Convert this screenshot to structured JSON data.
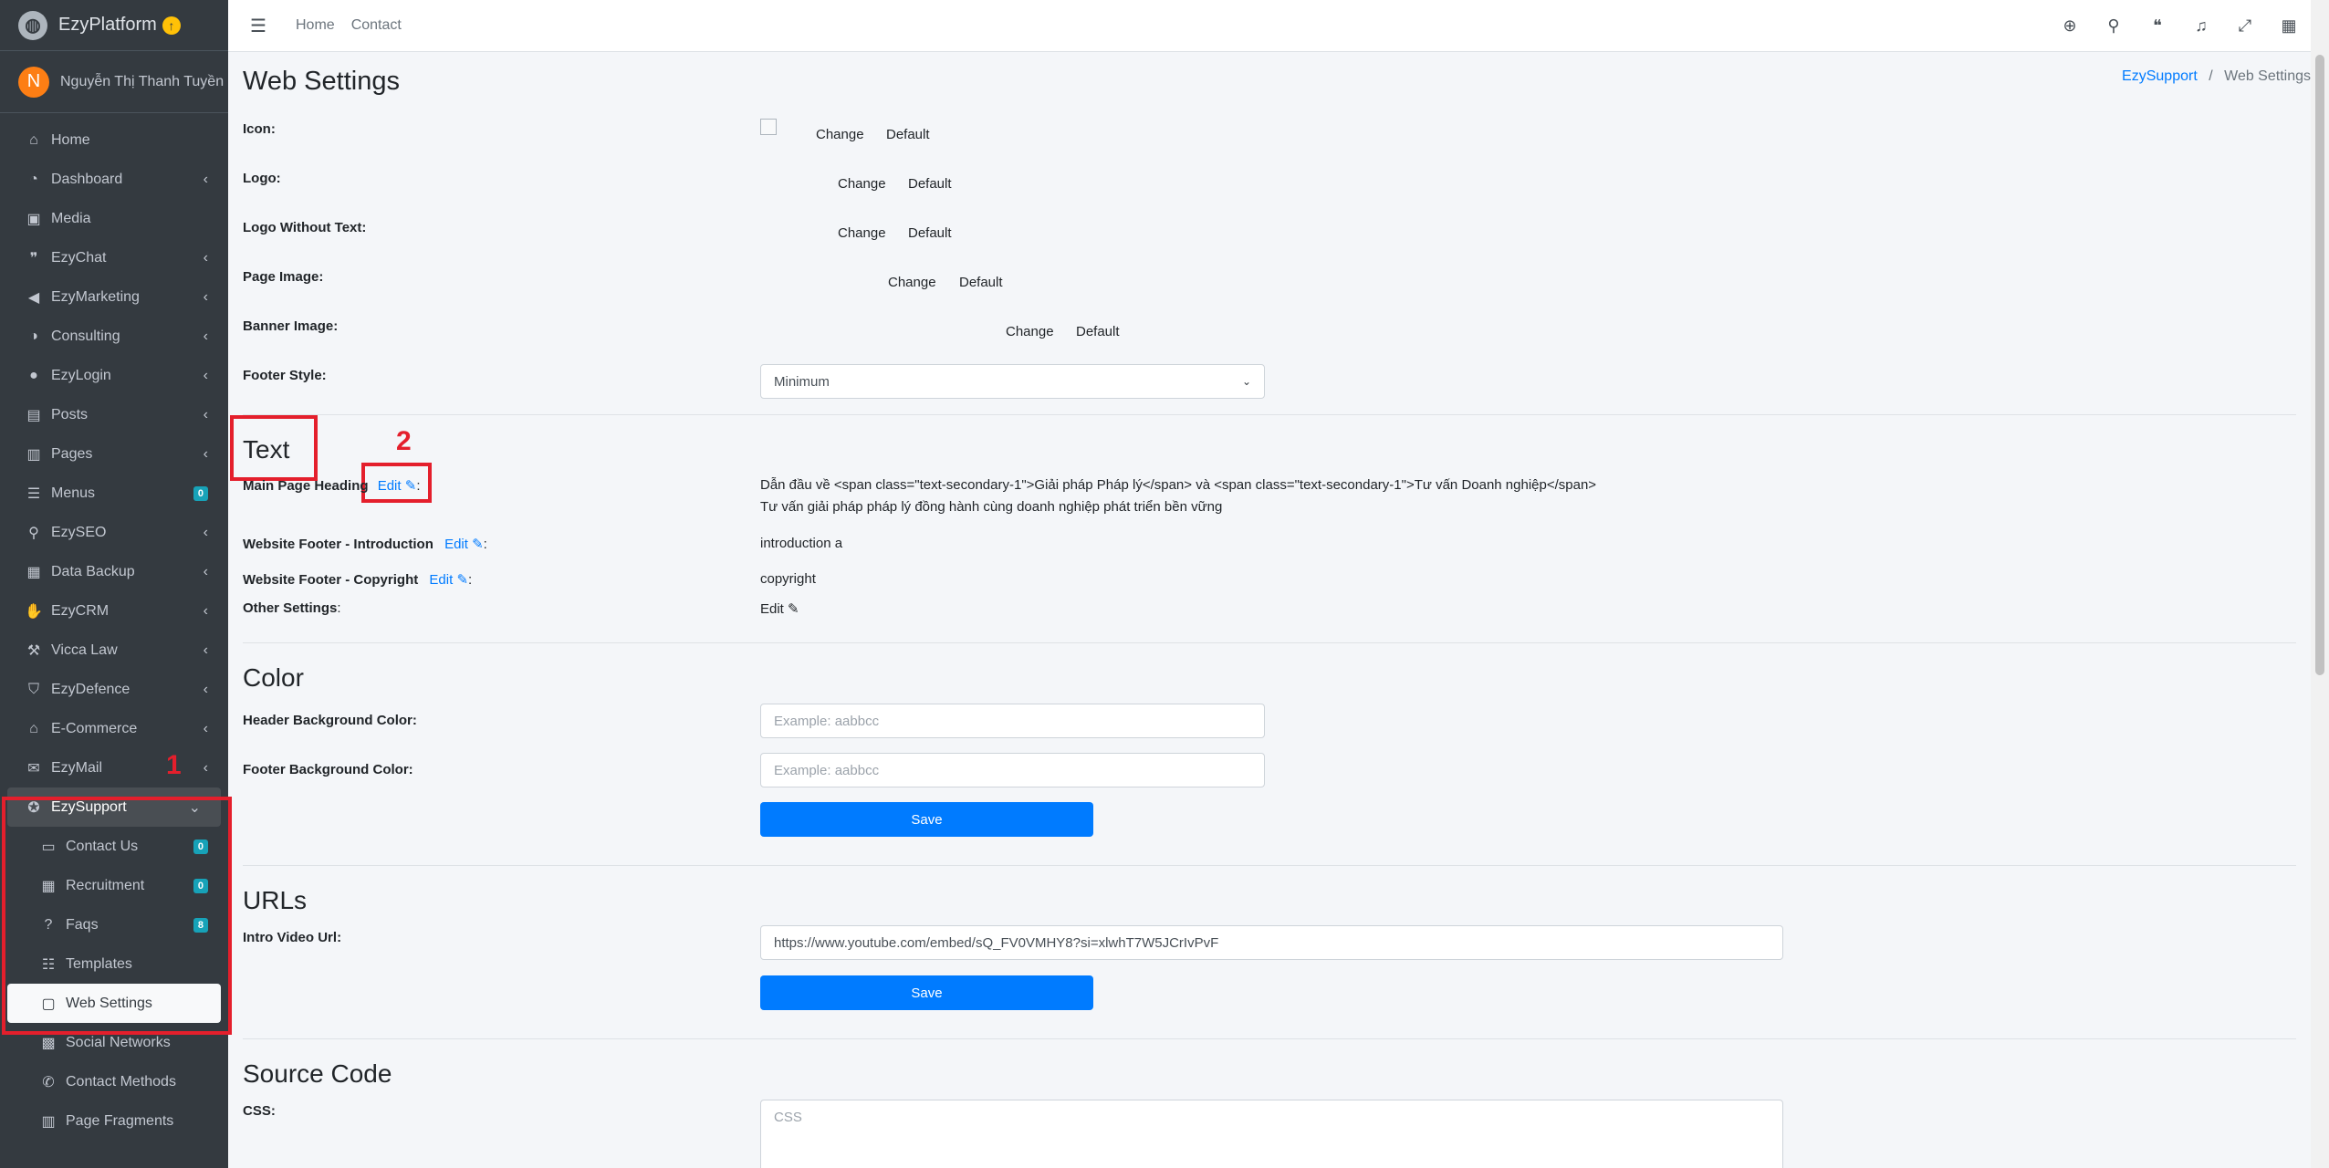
{
  "brand": {
    "name": "EzyPlatform",
    "badge_icon": "arrow-up-circle-icon"
  },
  "user": {
    "initial": "N",
    "name": "Nguyễn Thị Thanh Tuyền"
  },
  "sidebar": {
    "items": [
      {
        "label": "Home",
        "icon": "home-icon"
      },
      {
        "label": "Dashboard",
        "icon": "dashboard-icon"
      },
      {
        "label": "Media",
        "icon": "image-icon"
      },
      {
        "label": "EzyChat",
        "icon": "chat-icon"
      },
      {
        "label": "EzyMarketing",
        "icon": "megaphone-icon"
      },
      {
        "label": "Consulting",
        "icon": "headset-icon"
      },
      {
        "label": "EzyLogin",
        "icon": "user-lock-icon"
      },
      {
        "label": "Posts",
        "icon": "newspaper-icon"
      },
      {
        "label": "Pages",
        "icon": "book-icon"
      },
      {
        "label": "Menus",
        "icon": "bars-icon",
        "badge": "0"
      },
      {
        "label": "EzySEO",
        "icon": "search-icon"
      },
      {
        "label": "Data Backup",
        "icon": "database-icon"
      },
      {
        "label": "EzyCRM",
        "icon": "handshake-icon"
      },
      {
        "label": "Vicca Law",
        "icon": "gavel-icon"
      },
      {
        "label": "EzyDefence",
        "icon": "shield-icon"
      },
      {
        "label": "E-Commerce",
        "icon": "store-icon"
      },
      {
        "label": "EzyMail",
        "icon": "envelope-icon"
      },
      {
        "label": "EzySupport",
        "icon": "lifebuoy-icon"
      }
    ],
    "sub_items": [
      {
        "label": "Contact Us",
        "icon": "inbox-icon",
        "badge": "0"
      },
      {
        "label": "Recruitment",
        "icon": "grid-icon",
        "badge": "0"
      },
      {
        "label": "Faqs",
        "icon": "question-icon",
        "badge": "8"
      },
      {
        "label": "Templates",
        "icon": "list-icon"
      },
      {
        "label": "Web Settings",
        "icon": "window-icon"
      },
      {
        "label": "Social Networks",
        "icon": "share-icon"
      },
      {
        "label": "Contact Methods",
        "icon": "phone-icon"
      },
      {
        "label": "Page Fragments",
        "icon": "columns-icon"
      }
    ],
    "annotation_1": "1"
  },
  "topbar": {
    "home": "Home",
    "contact": "Contact",
    "icons": [
      "globe-icon",
      "search-icon",
      "comments-icon",
      "bell-icon",
      "expand-icon",
      "apps-icon"
    ]
  },
  "page": {
    "title": "Web Settings",
    "breadcrumb": {
      "parent": "EzySupport",
      "separator": "/",
      "current": "Web Settings"
    }
  },
  "images": {
    "icon_label": "Icon:",
    "logo_label": "Logo:",
    "logo_without_text_label": "Logo Without Text:",
    "page_image_label": "Page Image:",
    "banner_image_label": "Banner Image:",
    "footer_style_label": "Footer Style:",
    "change": "Change",
    "default": "Default",
    "footer_style_value": "Minimum"
  },
  "text_section": {
    "title": "Text",
    "annotation_2": "2",
    "main_heading_label": "Main Page Heading",
    "edit": "Edit",
    "colon": ":",
    "main_heading_line1": "Dẫn đầu về <span class=\"text-secondary-1\">Giải pháp Pháp lý</span> và <span class=\"text-secondary-1\">Tư vấn Doanh nghiệp</span>",
    "main_heading_line2": "Tư vấn giải pháp pháp lý đồng hành cùng doanh nghiệp phát triển bền vững",
    "footer_intro_label": "Website Footer - Introduction",
    "footer_intro_value": "introduction a",
    "footer_copyright_label": "Website Footer - Copyright",
    "footer_copyright_value": "copyright",
    "other_settings_label": "Other Settings",
    "other_colon": ":"
  },
  "color_section": {
    "title": "Color",
    "header_bg_label": "Header Background Color:",
    "footer_bg_label": "Footer Background Color:",
    "placeholder": "Example: aabbcc",
    "save": "Save"
  },
  "urls_section": {
    "title": "URLs",
    "intro_video_label": "Intro Video Url:",
    "intro_video_value": "https://www.youtube.com/embed/sQ_FV0VMHY8?si=xlwhT7W5JCrIvPvF",
    "save": "Save"
  },
  "source_section": {
    "title": "Source Code",
    "css_label": "CSS:",
    "css_placeholder": "CSS"
  }
}
